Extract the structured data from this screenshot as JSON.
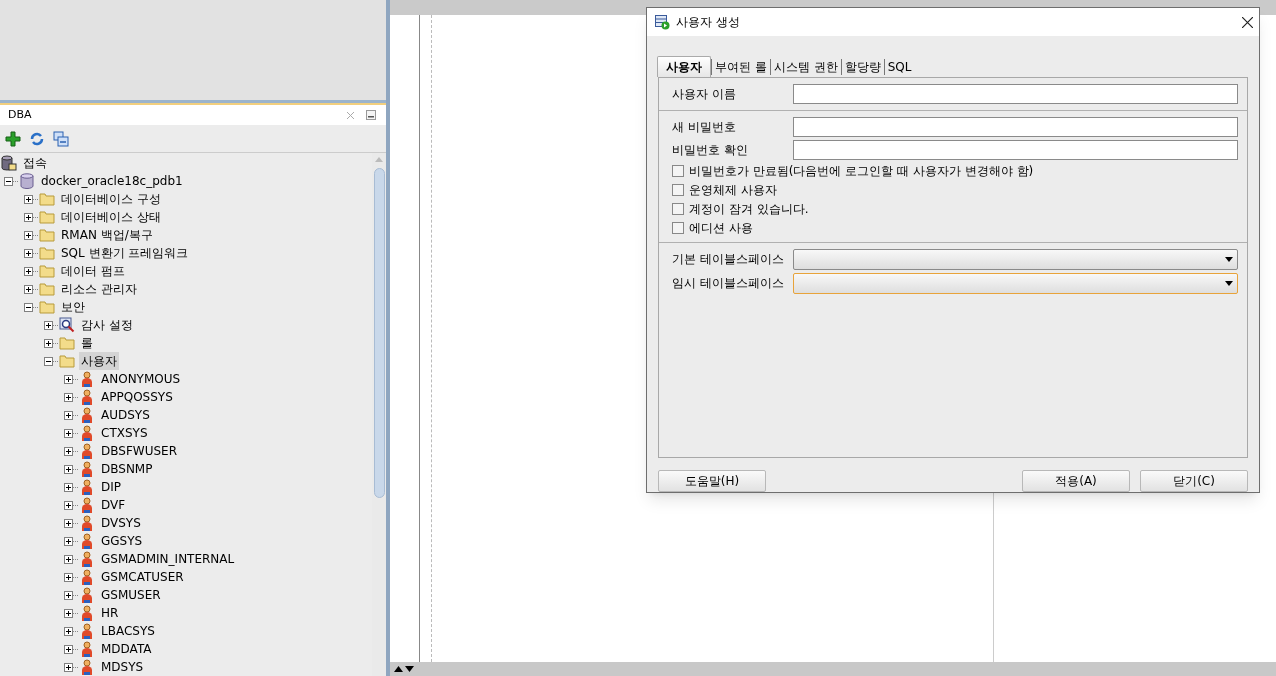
{
  "panel": {
    "title": "DBA"
  },
  "tree": [
    {
      "label": "접속",
      "kind": "connections",
      "selected": false,
      "children": [
        {
          "label": "docker_oracle18c_pdb1",
          "kind": "database",
          "expanded": true,
          "selected": false,
          "children": [
            {
              "label": "데이터베이스 구성",
              "kind": "folder",
              "expanded": false,
              "selected": false
            },
            {
              "label": "데이터베이스 상태",
              "kind": "folder",
              "expanded": false,
              "selected": false
            },
            {
              "label": "RMAN 백업/복구",
              "kind": "folder",
              "expanded": false,
              "selected": false
            },
            {
              "label": "SQL 변환기 프레임워크",
              "kind": "folder",
              "expanded": false,
              "selected": false
            },
            {
              "label": "데이터 펌프",
              "kind": "folder",
              "expanded": false,
              "selected": false
            },
            {
              "label": "리소스 관리자",
              "kind": "folder",
              "expanded": false,
              "selected": false
            },
            {
              "label": "보안",
              "kind": "folder",
              "expanded": true,
              "selected": false,
              "children": [
                {
                  "label": "감사 설정",
                  "kind": "audit",
                  "expanded": false,
                  "selected": false
                },
                {
                  "label": "롤",
                  "kind": "folder",
                  "expanded": false,
                  "selected": false
                },
                {
                  "label": "사용자",
                  "kind": "folder",
                  "expanded": true,
                  "selected": true,
                  "children": [
                    {
                      "label": "ANONYMOUS",
                      "kind": "user",
                      "expanded": false,
                      "selected": false
                    },
                    {
                      "label": "APPQOSSYS",
                      "kind": "user",
                      "expanded": false,
                      "selected": false
                    },
                    {
                      "label": "AUDSYS",
                      "kind": "user",
                      "expanded": false,
                      "selected": false
                    },
                    {
                      "label": "CTXSYS",
                      "kind": "user",
                      "expanded": false,
                      "selected": false
                    },
                    {
                      "label": "DBSFWUSER",
                      "kind": "user",
                      "expanded": false,
                      "selected": false
                    },
                    {
                      "label": "DBSNMP",
                      "kind": "user",
                      "expanded": false,
                      "selected": false
                    },
                    {
                      "label": "DIP",
                      "kind": "user",
                      "expanded": false,
                      "selected": false
                    },
                    {
                      "label": "DVF",
                      "kind": "user",
                      "expanded": false,
                      "selected": false
                    },
                    {
                      "label": "DVSYS",
                      "kind": "user",
                      "expanded": false,
                      "selected": false
                    },
                    {
                      "label": "GGSYS",
                      "kind": "user",
                      "expanded": false,
                      "selected": false
                    },
                    {
                      "label": "GSMADMIN_INTERNAL",
                      "kind": "user",
                      "expanded": false,
                      "selected": false
                    },
                    {
                      "label": "GSMCATUSER",
                      "kind": "user",
                      "expanded": false,
                      "selected": false
                    },
                    {
                      "label": "GSMUSER",
                      "kind": "user",
                      "expanded": false,
                      "selected": false
                    },
                    {
                      "label": "HR",
                      "kind": "user",
                      "expanded": false,
                      "selected": false
                    },
                    {
                      "label": "LBACSYS",
                      "kind": "user",
                      "expanded": false,
                      "selected": false
                    },
                    {
                      "label": "MDDATA",
                      "kind": "user",
                      "expanded": false,
                      "selected": false
                    },
                    {
                      "label": "MDSYS",
                      "kind": "user",
                      "expanded": false,
                      "selected": false
                    }
                  ]
                }
              ]
            }
          ]
        }
      ]
    }
  ],
  "dialog": {
    "title": "사용자 생성",
    "tabs": [
      {
        "label": "사용자",
        "selected": true
      },
      {
        "label": "부여된 롤",
        "selected": false
      },
      {
        "label": "시스템 권한",
        "selected": false
      },
      {
        "label": "할당량",
        "selected": false
      },
      {
        "label": "SQL",
        "selected": false
      }
    ],
    "sections": [
      {
        "items": [
          {
            "kind": "text",
            "label": "사용자 이름"
          }
        ]
      },
      {
        "items": [
          {
            "kind": "text",
            "label": "새 비밀번호"
          },
          {
            "kind": "text",
            "label": "비밀번호 확인"
          },
          {
            "kind": "checkbox",
            "label": "비밀번호가 만료됨(다음번에 로그인할 때 사용자가 변경해야 함)",
            "checked": false
          },
          {
            "kind": "checkbox",
            "label": "운영체제 사용자",
            "checked": false
          },
          {
            "kind": "checkbox",
            "label": "계정이 잠겨 있습니다.",
            "checked": false
          },
          {
            "kind": "checkbox",
            "label": "에디션 사용",
            "checked": false
          }
        ]
      },
      {
        "items": [
          {
            "kind": "select",
            "label": "기본 테이블스페이스",
            "focused": false
          },
          {
            "kind": "select",
            "label": "임시 테이블스페이스",
            "focused": true
          }
        ]
      }
    ],
    "buttons": [
      {
        "label": "도움말(H)",
        "kind": "help"
      },
      {
        "label": "적용(A)",
        "kind": "action"
      },
      {
        "label": "닫기(C)",
        "kind": "action"
      }
    ]
  }
}
